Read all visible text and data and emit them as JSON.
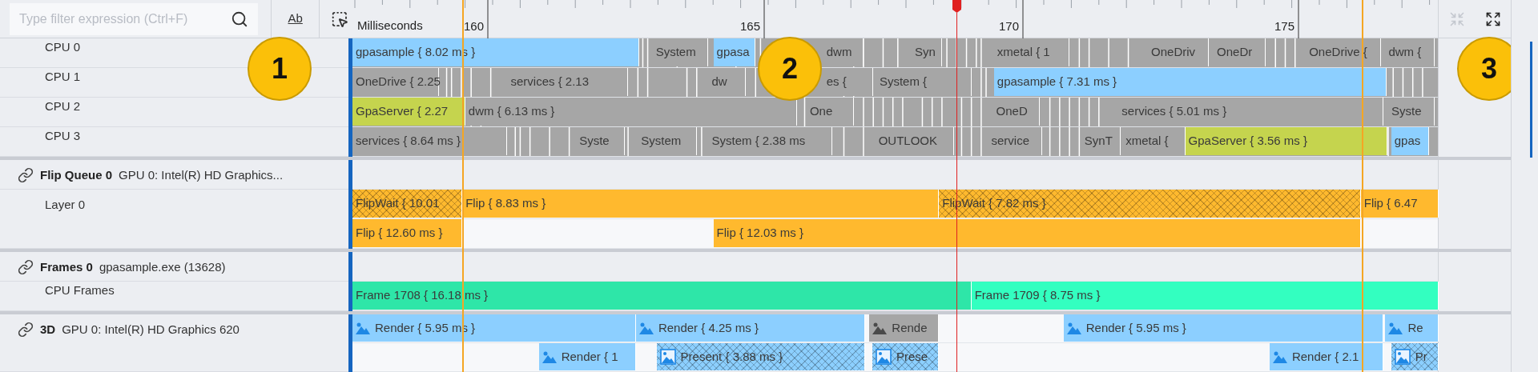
{
  "filter": {
    "placeholder": "Type filter expression (Ctrl+F)"
  },
  "toolbar": {
    "match_case": "Ab"
  },
  "ruler": {
    "unit": "Milliseconds",
    "ticks": [
      "160",
      "165",
      "170",
      "175"
    ]
  },
  "cpu_rows": [
    {
      "label": "CPU 0",
      "segments": [
        {
          "label": "gpasample { 8.02 ms }",
          "color": "#8ccfff"
        },
        {
          "label": "System",
          "color": "#a6a6a6"
        },
        {
          "label": "gpasa",
          "color": "#8ccfff"
        },
        {
          "label": "dwm",
          "color": "#a6a6a6"
        },
        {
          "label": "Syn",
          "color": "#a6a6a6"
        },
        {
          "label": "xmetal { 1",
          "color": "#a6a6a6"
        },
        {
          "label": "OneDriv",
          "color": "#a6a6a6"
        },
        {
          "label": "OneDr",
          "color": "#a6a6a6"
        },
        {
          "label": "OneDrive {",
          "color": "#a6a6a6"
        },
        {
          "label": "dwm {",
          "color": "#a6a6a6"
        }
      ]
    },
    {
      "label": "CPU 1",
      "segments": [
        {
          "label": "OneDrive { 2.25",
          "color": "#a6a6a6"
        },
        {
          "label": "services { 2.13",
          "color": "#a6a6a6"
        },
        {
          "label": "dw",
          "color": "#a6a6a6"
        },
        {
          "label": "es {",
          "color": "#a6a6a6"
        },
        {
          "label": "System {",
          "color": "#a6a6a6"
        },
        {
          "label": "gpasample { 7.31 ms }",
          "color": "#8ccfff"
        }
      ]
    },
    {
      "label": "CPU 2",
      "segments": [
        {
          "label": "GpaServer { 2.27",
          "color": "#c5d44e"
        },
        {
          "label": "dwm { 6.13 ms }",
          "color": "#a6a6a6"
        },
        {
          "label": "One",
          "color": "#a6a6a6"
        },
        {
          "label": "OneD",
          "color": "#a6a6a6"
        },
        {
          "label": "services { 5.01 ms }",
          "color": "#a6a6a6"
        },
        {
          "label": "Syste",
          "color": "#a6a6a6"
        }
      ]
    },
    {
      "label": "CPU 3",
      "segments": [
        {
          "label": "services { 8.64 ms }",
          "color": "#a6a6a6"
        },
        {
          "label": "Syste",
          "color": "#a6a6a6"
        },
        {
          "label": "System",
          "color": "#a6a6a6"
        },
        {
          "label": "System { 2.38 ms",
          "color": "#a6a6a6"
        },
        {
          "label": "OUTLOOK",
          "color": "#a6a6a6"
        },
        {
          "label": "service",
          "color": "#a6a6a6"
        },
        {
          "label": "SynT",
          "color": "#a6a6a6"
        },
        {
          "label": "xmetal {",
          "color": "#a6a6a6"
        },
        {
          "label": "GpaServer { 3.56 ms }",
          "color": "#c5d44e"
        },
        {
          "label": "gpas",
          "color": "#8ccfff"
        }
      ]
    }
  ],
  "flip_queue": {
    "title": "Flip Queue 0",
    "subtitle": "GPU 0: Intel(R) HD Graphics...",
    "layers": [
      {
        "label": "Layer 0",
        "lanes": [
          [
            {
              "label": "FlipWait { 10.01",
              "color": "#ffb92e",
              "hatched": true
            },
            {
              "label": "Flip { 8.83 ms }",
              "color": "#ffb92e",
              "hatched": false
            },
            {
              "label": "FlipWait { 7.82 ms }",
              "color": "#ffb92e",
              "hatched": true
            },
            {
              "label": "Flip { 6.47",
              "color": "#ffb92e",
              "hatched": false
            }
          ],
          [
            {
              "label": "Flip { 12.60 ms }",
              "color": "#ffb92e",
              "hatched": false
            },
            {
              "label": "Flip { 12.03 ms }",
              "color": "#ffb92e",
              "hatched": false
            }
          ]
        ]
      }
    ]
  },
  "frames": {
    "title": "Frames 0",
    "subtitle": "gpasample.exe (13628)",
    "rows": [
      {
        "label": "CPU Frames",
        "segments": [
          {
            "label": "Frame 1708 { 16.18 ms }",
            "color": "#2ee6a8"
          },
          {
            "label": "Frame 1709 { 8.75 ms }",
            "color": "#33ffc0"
          }
        ]
      }
    ]
  },
  "gpu_3d": {
    "title": "3D",
    "subtitle": "GPU 0: Intel(R) HD Graphics 620",
    "lanes": [
      [
        {
          "label": "Render { 5.95 ms }",
          "kind": "render",
          "color": "#8ccfff",
          "hatched": false
        },
        {
          "label": "Render { 4.25 ms }",
          "kind": "render",
          "color": "#8ccfff",
          "hatched": false
        },
        {
          "label": "Rende",
          "kind": "render",
          "color": "#a6a6a6",
          "hatched": false
        },
        {
          "label": "Render { 5.95 ms }",
          "kind": "render",
          "color": "#8ccfff",
          "hatched": false
        },
        {
          "label": "Re",
          "kind": "render",
          "color": "#8ccfff",
          "hatched": false
        }
      ],
      [
        {
          "label": "Render { 1",
          "kind": "render",
          "color": "#8ccfff",
          "hatched": false
        },
        {
          "label": "Present { 3.88 ms }",
          "kind": "present",
          "color": "#8ccfff",
          "hatched": true
        },
        {
          "label": "Prese",
          "kind": "present",
          "color": "#8ccfff",
          "hatched": true
        },
        {
          "label": "Render { 2.1",
          "kind": "render",
          "color": "#8ccfff",
          "hatched": false
        },
        {
          "label": "Pr",
          "kind": "present",
          "color": "#8ccfff",
          "hatched": true
        }
      ]
    ]
  },
  "callouts": [
    "1",
    "2",
    "3"
  ]
}
